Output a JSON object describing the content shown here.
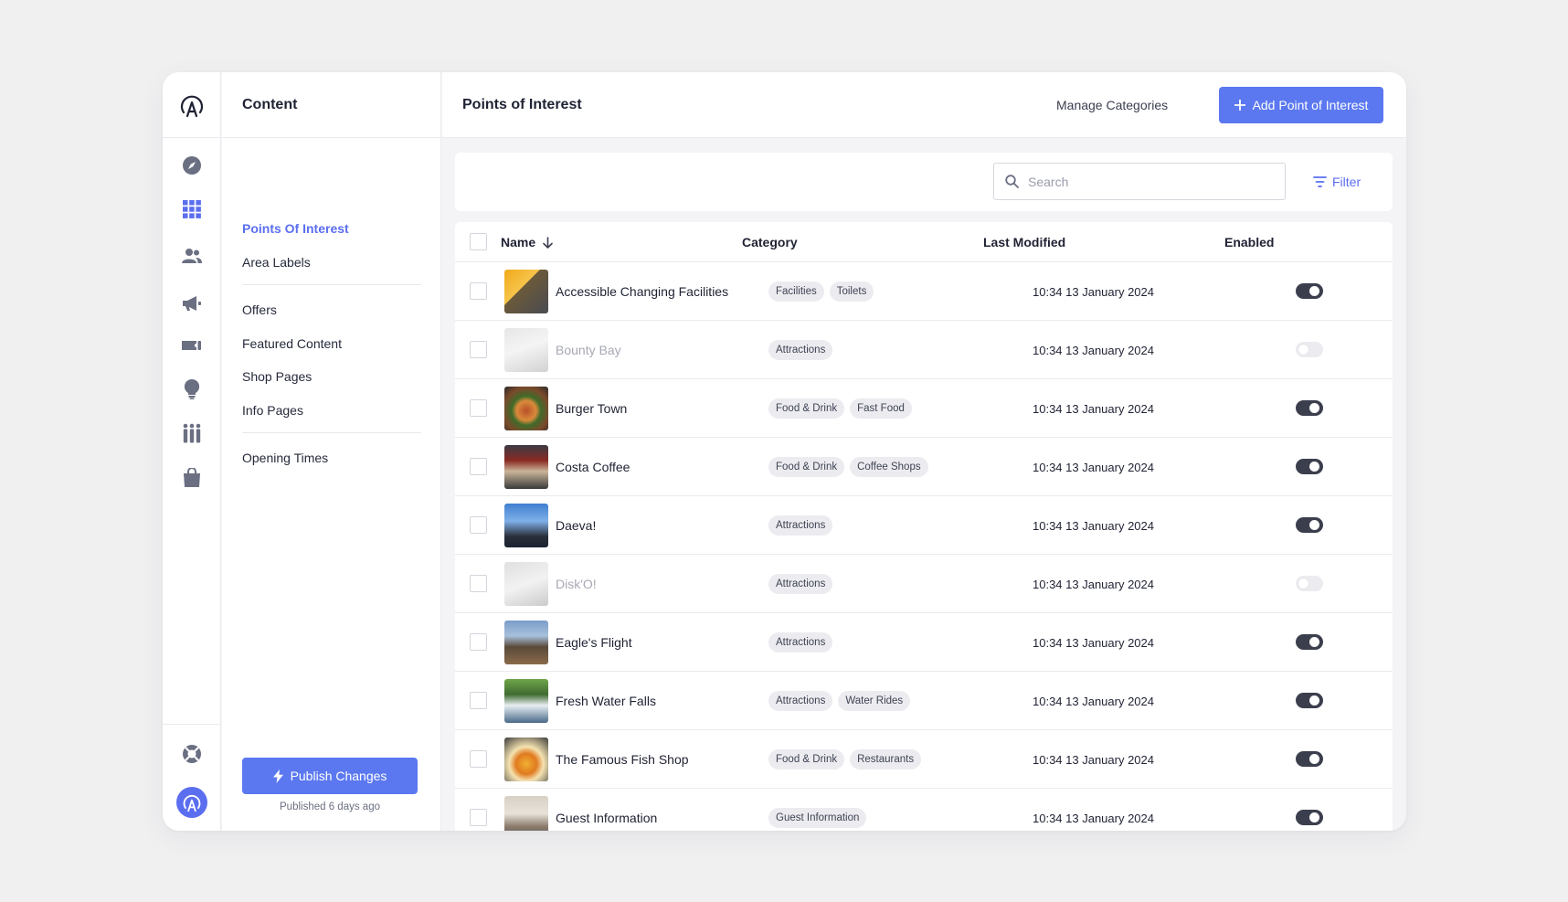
{
  "colors": {
    "accent": "#5b78f0",
    "toggle_on": "#3b3f4d",
    "toggle_off": "#ececf0"
  },
  "sidebar": {
    "title": "Content",
    "items": [
      {
        "label": "Points Of Interest",
        "active": true
      },
      {
        "label": "Area Labels"
      },
      {
        "label": "Offers"
      },
      {
        "label": "Featured Content"
      },
      {
        "label": "Shop Pages"
      },
      {
        "label": "Info Pages"
      },
      {
        "label": "Opening Times"
      }
    ],
    "publish_label": "Publish Changes",
    "published_text": "Published 6 days ago"
  },
  "rail_icons": [
    "compass-icon",
    "grid-icon",
    "people-icon",
    "megaphone-icon",
    "ticket-icon",
    "lightbulb-icon",
    "queue-icon",
    "shopping-bag-icon",
    "lifebuoy-icon"
  ],
  "header": {
    "title": "Points of Interest",
    "manage_label": "Manage Categories",
    "add_label": "Add Point of Interest"
  },
  "search": {
    "placeholder": "Search",
    "value": ""
  },
  "filter_label": "Filter",
  "table": {
    "columns": [
      "Name",
      "Category",
      "Last Modified",
      "Enabled"
    ],
    "rows": [
      {
        "name": "Accessible Changing Facilities",
        "tags": [
          "Facilities",
          "Toilets"
        ],
        "modified": "10:34 13 January 2024",
        "enabled": true
      },
      {
        "name": "Bounty Bay",
        "tags": [
          "Attractions"
        ],
        "modified": "10:34 13 January 2024",
        "enabled": false
      },
      {
        "name": "Burger Town",
        "tags": [
          "Food & Drink",
          "Fast Food"
        ],
        "modified": "10:34 13 January 2024",
        "enabled": true
      },
      {
        "name": "Costa Coffee",
        "tags": [
          "Food & Drink",
          "Coffee Shops"
        ],
        "modified": "10:34 13 January 2024",
        "enabled": true
      },
      {
        "name": "Daeva!",
        "tags": [
          "Attractions"
        ],
        "modified": "10:34 13 January 2024",
        "enabled": true
      },
      {
        "name": "Disk'O!",
        "tags": [
          "Attractions"
        ],
        "modified": "10:34 13 January 2024",
        "enabled": false
      },
      {
        "name": "Eagle's Flight",
        "tags": [
          "Attractions"
        ],
        "modified": "10:34 13 January 2024",
        "enabled": true
      },
      {
        "name": "Fresh Water Falls",
        "tags": [
          "Attractions",
          "Water Rides"
        ],
        "modified": "10:34 13 January 2024",
        "enabled": true
      },
      {
        "name": "The Famous Fish Shop",
        "tags": [
          "Food & Drink",
          "Restaurants"
        ],
        "modified": "10:34 13 January 2024",
        "enabled": true
      },
      {
        "name": "Guest Information",
        "tags": [
          "Guest Information"
        ],
        "modified": "10:34 13 January 2024",
        "enabled": true
      }
    ]
  }
}
